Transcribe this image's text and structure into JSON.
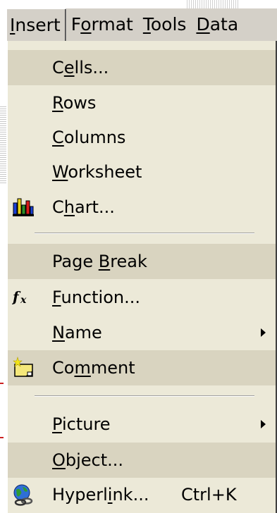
{
  "menubar": {
    "items": [
      {
        "label": "Insert",
        "mnemonic_index": 0
      },
      {
        "label": "Format",
        "mnemonic_index": 1
      },
      {
        "label": "Tools",
        "mnemonic_index": 0
      },
      {
        "label": "Data",
        "mnemonic_index": 0
      }
    ]
  },
  "menu": {
    "items": [
      {
        "pre": "C",
        "mn": "e",
        "post": "lls..."
      },
      {
        "pre": "",
        "mn": "R",
        "post": "ows"
      },
      {
        "pre": "",
        "mn": "C",
        "post": "olumns"
      },
      {
        "pre": "",
        "mn": "W",
        "post": "orksheet"
      },
      {
        "pre": "C",
        "mn": "h",
        "post": "art...",
        "icon": "chart-icon"
      },
      {
        "pre": "Page ",
        "mn": "B",
        "post": "reak"
      },
      {
        "pre": "",
        "mn": "F",
        "post": "unction...",
        "icon": "function-icon"
      },
      {
        "pre": "",
        "mn": "N",
        "post": "ame",
        "submenu": true
      },
      {
        "pre": "Co",
        "mn": "m",
        "post": "ment",
        "icon": "new-comment-icon"
      },
      {
        "pre": "",
        "mn": "P",
        "post": "icture",
        "submenu": true
      },
      {
        "pre": "",
        "mn": "O",
        "post": "bject..."
      },
      {
        "pre": "Hyperl",
        "mn": "i",
        "post": "nk...",
        "shortcut": "Ctrl+K",
        "icon": "hyperlink-globe-icon"
      }
    ]
  },
  "colors": {
    "menu_background": "#ece9d8",
    "highlight_band": "#d9d4c0",
    "menubar_background": "#d4d0c8"
  }
}
